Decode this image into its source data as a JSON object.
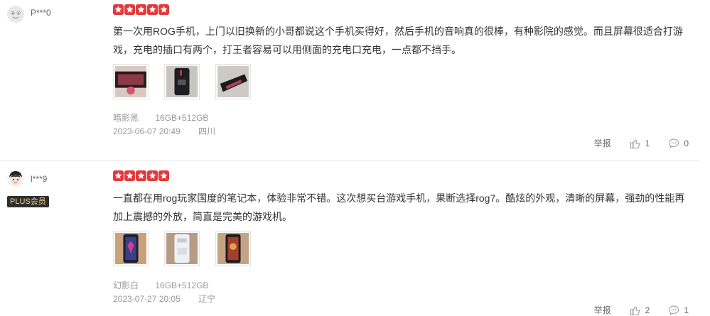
{
  "reviews": [
    {
      "username": "P***0",
      "rating": 5,
      "text": "第一次用ROG手机，上门以旧换新的小哥都说这个手机买得好，然后手机的音响真的很棒，有种影院的感觉。而且屏幕很适合打游戏，充电的插口有两个，打王者容易可以用侧面的充电口充电，一点都不挡手。",
      "color": "暗影黑",
      "spec": "16GB+512GB",
      "date": "2023-06-07 20:49",
      "location": "四川",
      "report_label": "举报",
      "likes": "1",
      "comments": "0"
    },
    {
      "username": "l***9",
      "badge": "PLUS会员",
      "rating": 5,
      "text": "一直都在用rog玩家国度的笔记本，体验非常不错。这次想买台游戏手机，果断选择rog7。酷炫的外观，清晰的屏幕，强劲的性能再加上震撼的外放，简直是完美的游戏机。",
      "color": "幻影白",
      "spec": "16GB+512GB",
      "date": "2023-07-27 20:05",
      "location": "辽宁",
      "report_label": "举报",
      "likes": "2",
      "comments": "1"
    }
  ],
  "colors": {
    "star": "#e4393c",
    "badge_bg": "#2e2e2e",
    "badge_text": "#f3d28c"
  }
}
